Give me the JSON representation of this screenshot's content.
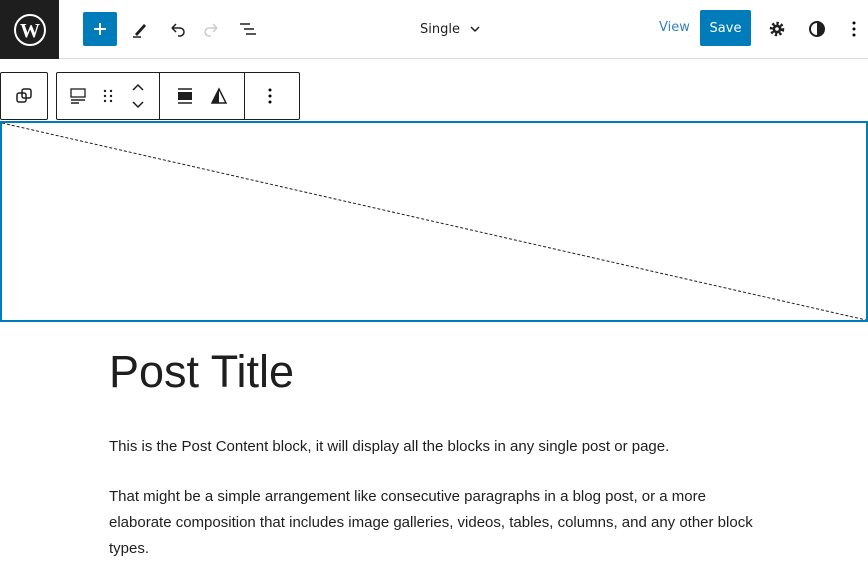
{
  "header": {
    "template_name": "Single",
    "view_label": "View",
    "save_label": "Save"
  },
  "icons": [
    "wordpress-logo",
    "plus-icon",
    "pencil-icon",
    "undo-icon",
    "redo-icon",
    "list-view-icon",
    "chevron-down-icon",
    "gear-icon",
    "contrast-icon",
    "more-vertical-icon"
  ],
  "content": {
    "title": "Post Title",
    "paragraphs": [
      "This is the Post Content block, it will display all the blocks in any single post or page.",
      "That might be a simple arrangement like consecutive paragraphs in a blog post, or a more elaborate composition that includes image galleries, videos, tables, columns, and any other block types."
    ]
  },
  "colors": {
    "accent": "#007cba",
    "dark": "#1e1e1e"
  }
}
